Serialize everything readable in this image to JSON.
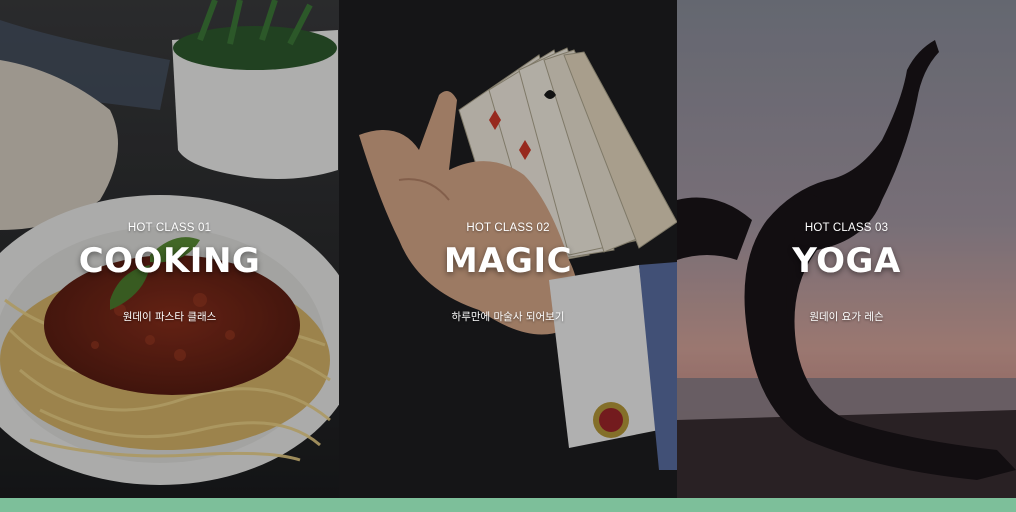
{
  "panels": [
    {
      "tag": "HOT CLASS 01",
      "title": "COOKING",
      "desc": "원데이 파스타 클래스"
    },
    {
      "tag": "HOT CLASS 02",
      "title": "MAGIC",
      "desc": "하루만에 마술사 되어보기"
    },
    {
      "tag": "HOT CLASS 03",
      "title": "YOGA",
      "desc": "원데이 요가 레슨"
    }
  ],
  "colors": {
    "bottom_bar": "#7dbf9a",
    "caption_text": "#ffffff"
  }
}
